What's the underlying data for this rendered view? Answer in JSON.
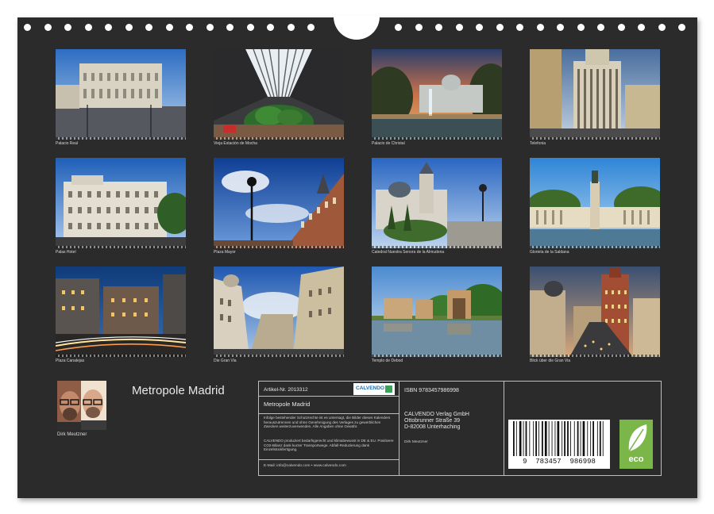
{
  "calendar": {
    "title": "Metropole Madrid",
    "author": "Dirk Meutzner",
    "photos": [
      {
        "caption": "Palacio Real"
      },
      {
        "caption": "Vieja Estación de Mocha"
      },
      {
        "caption": "Palacio de Christal"
      },
      {
        "caption": "Telefonia"
      },
      {
        "caption": "Palas Hotel"
      },
      {
        "caption": "Plaza Mayor"
      },
      {
        "caption": "Catedral Nuestra Senora de la Almudena"
      },
      {
        "caption": "Glorieta de la Saldana"
      },
      {
        "caption": "Plaza Canalejas"
      },
      {
        "caption": "Die Gran Via"
      },
      {
        "caption": "Templo de Debod"
      },
      {
        "caption": "Blick über die Gran Via"
      }
    ]
  },
  "info": {
    "article_no": "Artikel-Nr. 2013312",
    "product_title": "Metropole Madrid",
    "brand_logo": "CALVENDO",
    "legal_text": "Infolge bestehender Schutzrechte ist es untersagt, die Bilder dieses Kalenders herauszutrennen und ohne Genehmigung des Verlages zu gewerblichen Zwecken weiterzuverwenden. Alle Angaben ohne Gewähr.",
    "eco_text": "CALVENDO produziert bedarfsgerecht und klimabewusst in DE & EU. Positivere CO2-Bilanz dank kurzer Transportwege. Abfall-Reduzierung dank Einzelstückfertigung.",
    "contact": "E-Mail: info@calvendo.com • www.calvendo.com",
    "isbn": "ISBN 9783457986998",
    "publisher_name": "CALVENDO Verlag GmbH",
    "publisher_street": "Ottobrunner Straße 39",
    "publisher_city": "D-82008 Unterhaching",
    "photographer": "Dirk Meutzner",
    "barcode_digits": "9  783457  986998",
    "eco_label": "eco",
    "colors": {
      "eco_green": "#7ab648",
      "background": "#2b2b2b"
    }
  }
}
